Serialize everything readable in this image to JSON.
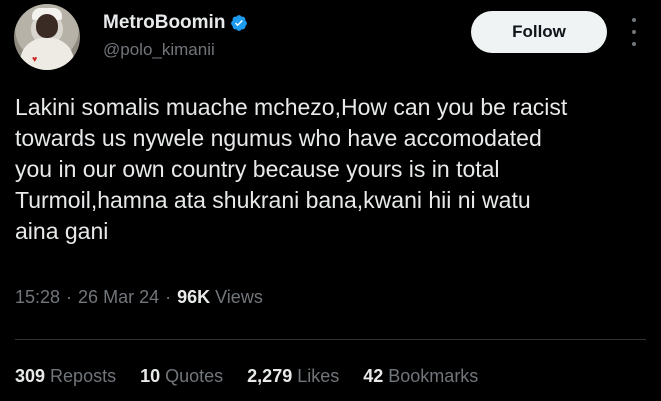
{
  "author": {
    "display_name": "MetroBoomin",
    "handle": "@polo_kimanii",
    "verified": true,
    "verified_color": "#1d9bf0"
  },
  "actions": {
    "follow_label": "Follow"
  },
  "tweet": {
    "text": "Lakini somalis muache mchezo,How can you be racist\ntowards us nywele ngumus who have accomodated\nyou in our own country because yours is in total\nTurmoil,hamna ata shukrani bana,kwani hii ni watu\naina gani",
    "time": "15:28",
    "date": "26 Mar 24",
    "views_count": "96K",
    "views_label": "Views",
    "separator": "·"
  },
  "stats": [
    {
      "count": "309",
      "label": "Reposts"
    },
    {
      "count": "10",
      "label": "Quotes"
    },
    {
      "count": "2,279",
      "label": "Likes"
    },
    {
      "count": "42",
      "label": "Bookmarks"
    }
  ]
}
